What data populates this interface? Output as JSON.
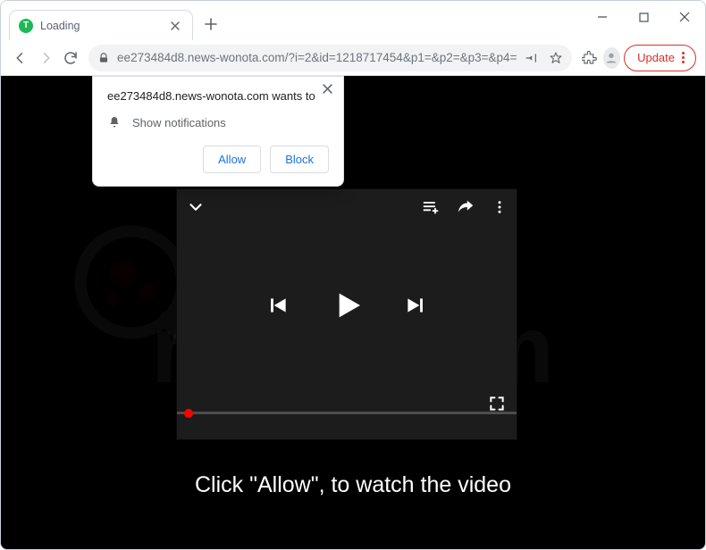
{
  "tab": {
    "title": "Loading",
    "favicon_letter": "T"
  },
  "url": {
    "host": "ee273484d8.news-wonota.com",
    "path": "/?i=2&id=1218717454&p1=&p2=&p3=&p4="
  },
  "toolbar": {
    "update_label": "Update"
  },
  "permission": {
    "title": "ee273484d8.news-wonota.com wants to",
    "line": "Show notifications",
    "allow_label": "Allow",
    "block_label": "Block"
  },
  "page": {
    "caption": "Click \"Allow\", to watch the video",
    "watermark": "risk.com"
  }
}
